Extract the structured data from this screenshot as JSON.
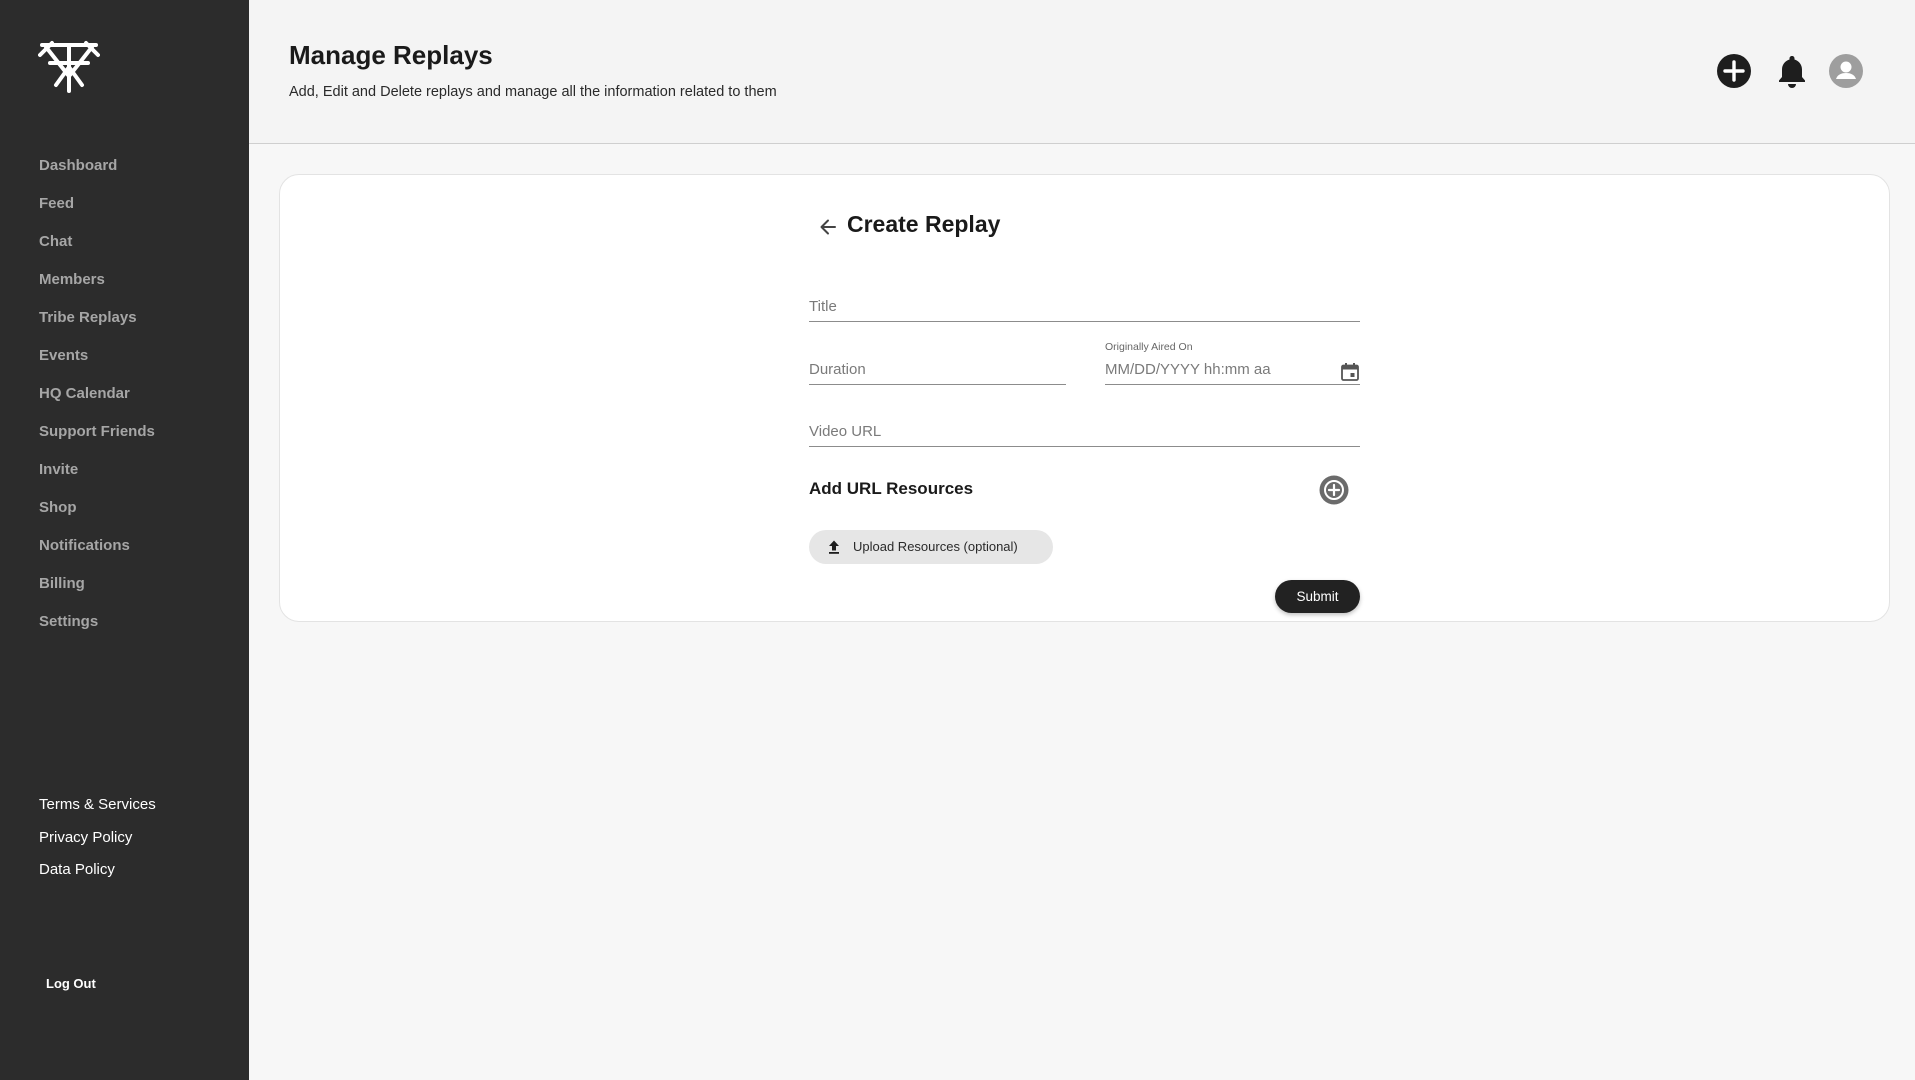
{
  "sidebar": {
    "nav": [
      {
        "label": "Dashboard"
      },
      {
        "label": "Feed"
      },
      {
        "label": "Chat"
      },
      {
        "label": "Members"
      },
      {
        "label": "Tribe Replays"
      },
      {
        "label": "Events"
      },
      {
        "label": "HQ Calendar"
      },
      {
        "label": "Support Friends"
      },
      {
        "label": "Invite"
      },
      {
        "label": "Shop"
      },
      {
        "label": "Notifications"
      },
      {
        "label": "Billing"
      },
      {
        "label": "Settings"
      }
    ],
    "legal": [
      {
        "label": "Terms & Services"
      },
      {
        "label": "Privacy Policy"
      },
      {
        "label": "Data Policy"
      }
    ],
    "logout_label": "Log Out"
  },
  "header": {
    "title": "Manage Replays",
    "subtitle": "Add, Edit and Delete replays and manage all the information related to them",
    "icons": [
      "add-circle-icon",
      "bell-icon",
      "account-icon"
    ]
  },
  "form": {
    "title": "Create Replay",
    "title_placeholder": "Title",
    "duration_placeholder": "Duration",
    "aired_label": "Originally Aired On",
    "aired_placeholder": "MM/DD/YYYY hh:mm aa",
    "video_placeholder": "Video URL",
    "url_resources_label": "Add URL Resources",
    "upload_label": "Upload Resources (optional)",
    "submit_label": "Submit"
  },
  "colors": {
    "sidebar_bg": "#2c2c2c",
    "nav_text": "#a6a6a6",
    "page_bg": "#f7f7f7",
    "card_bg": "#ffffff",
    "button_dark": "#222222"
  }
}
